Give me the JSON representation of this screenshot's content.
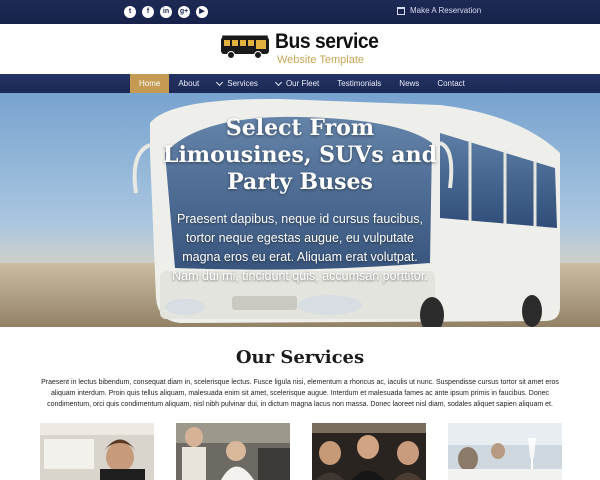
{
  "topbar": {
    "social": [
      {
        "icon": "twitter-icon",
        "glyph": "t"
      },
      {
        "icon": "facebook-icon",
        "glyph": "f"
      },
      {
        "icon": "linkedin-icon",
        "glyph": "in"
      },
      {
        "icon": "googleplus-icon",
        "glyph": "g+"
      },
      {
        "icon": "youtube-icon",
        "glyph": "▶"
      }
    ],
    "reservation_label": "Make A Reservation"
  },
  "logo": {
    "title": "Bus service",
    "subtitle": "Website Template"
  },
  "nav": {
    "items": [
      {
        "label": "Home",
        "active": true,
        "dropdown": false
      },
      {
        "label": "About",
        "active": false,
        "dropdown": false
      },
      {
        "label": "Services",
        "active": false,
        "dropdown": true
      },
      {
        "label": "Our Fleet",
        "active": false,
        "dropdown": true
      },
      {
        "label": "Testimonials",
        "active": false,
        "dropdown": false
      },
      {
        "label": "News",
        "active": false,
        "dropdown": false
      },
      {
        "label": "Contact",
        "active": false,
        "dropdown": false
      }
    ]
  },
  "hero": {
    "title": "Select From Limousines, SUVs and Party Buses",
    "text": "Praesent dapibus, neque id cursus faucibus, tortor neque egestas augue, eu vulputate magna eros eu erat. Aliquam erat volutpat. Nam dui mi, tincidunt quis, accumsan porttitor."
  },
  "services": {
    "title": "Our Services",
    "text": "Praesent in lectus bibendum, consequat diam in, scelerisque lectus. Fusce ligula nisi, elementum a rhoncus ac, iaculis ut nunc. Suspendisse cursus tortor sit amet eros aliquam interdum. Proin quis tellus aliquam, malesuada enim sit amet, scelerisque augue. Interdum et malesuada fames ac ante ipsum primis in faucibus. Donec condimentum, orci quis condimentum aliquam, nisl nibh pulvinar dui, in dictum magna lacus non massa. Donec laoreet nisl diam, sodales aliquet sapien aliquam et."
  },
  "colors": {
    "topbar": "#1d2a55",
    "nav": "#243466",
    "accent": "#c59a52",
    "logo_subtitle": "#c8a556"
  }
}
